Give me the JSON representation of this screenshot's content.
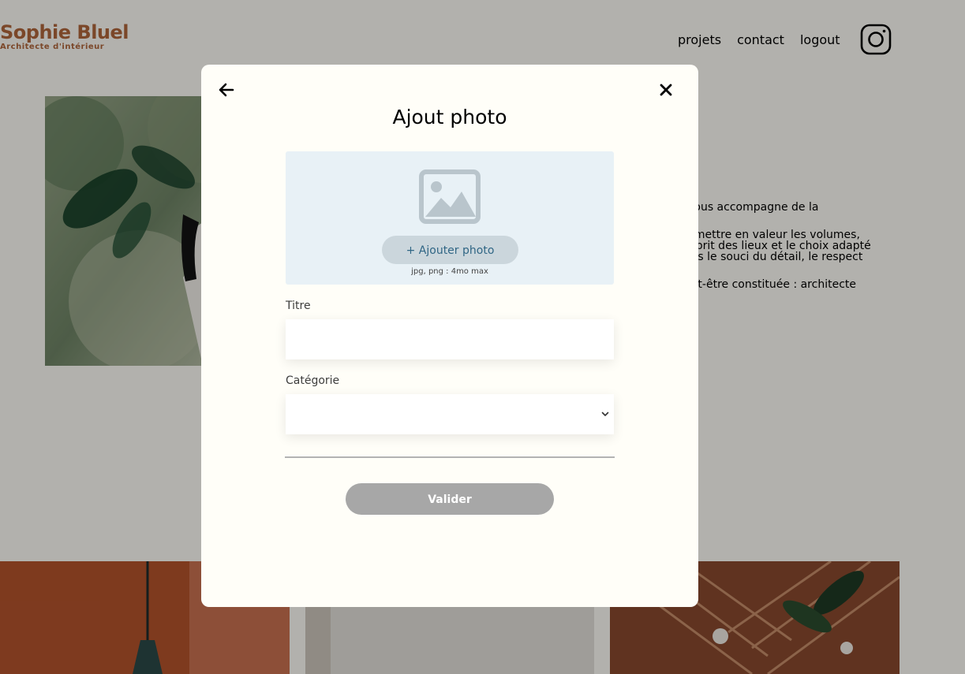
{
  "header": {
    "logo_title": "Sophie Bluel",
    "logo_subtitle": "Architecte d'intérieur",
    "nav": [
      "projets",
      "contact",
      "logout"
    ],
    "instagram_icon": "instagram-icon"
  },
  "intro": {
    "lines": [
      ". Je vous accompagne de la",
      "on à mettre en valeur les volumes,\ne l'esprit des lieux et le choix adapté\né dans le souci du détail, le respect",
      "e peut-être constituée : architecte"
    ]
  },
  "modal": {
    "title": "Ajout photo",
    "back_icon": "arrow-left-icon",
    "close_icon": "close-icon",
    "upload": {
      "icon": "image-placeholder-icon",
      "button_label": "+ Ajouter photo",
      "hint": "jpg, png : 4mo max"
    },
    "title_field": {
      "label": "Titre",
      "value": ""
    },
    "category_field": {
      "label": "Catégorie",
      "value": ""
    },
    "submit_label": "Valider"
  },
  "colors": {
    "brand": "#B1663C",
    "overlay": "rgba(0,0,0,0.30)",
    "modal_bg": "#FFFEF8",
    "upload_bg": "#E8F1F6",
    "upload_btn_bg": "#CBD6DC",
    "upload_btn_text": "#306685",
    "submit_disabled": "#A7A7A7"
  }
}
